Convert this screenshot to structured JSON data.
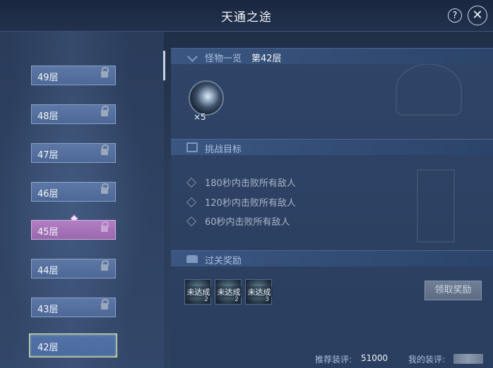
{
  "window": {
    "title": "天通之途",
    "help_glyph": "?",
    "close_glyph": "✕"
  },
  "floors": [
    {
      "label": "49层",
      "state": "locked"
    },
    {
      "label": "48层",
      "state": "locked"
    },
    {
      "label": "47层",
      "state": "locked"
    },
    {
      "label": "46层",
      "state": "locked"
    },
    {
      "label": "45层",
      "state": "highlighted-locked"
    },
    {
      "label": "44层",
      "state": "locked"
    },
    {
      "label": "43层",
      "state": "locked"
    },
    {
      "label": "42层",
      "state": "current"
    }
  ],
  "monsters": {
    "title": "怪物一览",
    "floor": "第42层",
    "entries": [
      {
        "name": "",
        "count": "×5"
      }
    ]
  },
  "objectives": {
    "title": "挑战目标",
    "items": [
      "180秒内击败所有敌人",
      "120秒内击败所有敌人",
      "60秒内击败所有敌人"
    ]
  },
  "rewards": {
    "title": "过关奖励",
    "items": [
      {
        "status": "未达成",
        "count": "2"
      },
      {
        "status": "未达成",
        "count": "2"
      },
      {
        "status": "未达成",
        "count": "3"
      }
    ],
    "claim_label": "领取奖励"
  },
  "footer": {
    "recommended_label": "推荐装评:",
    "recommended_value": "51000",
    "mine_label": "我的装评:"
  },
  "colors": {
    "active_floor": "#b27ec4",
    "header_text": "#a9c0e0",
    "panel": "#2f4467"
  }
}
